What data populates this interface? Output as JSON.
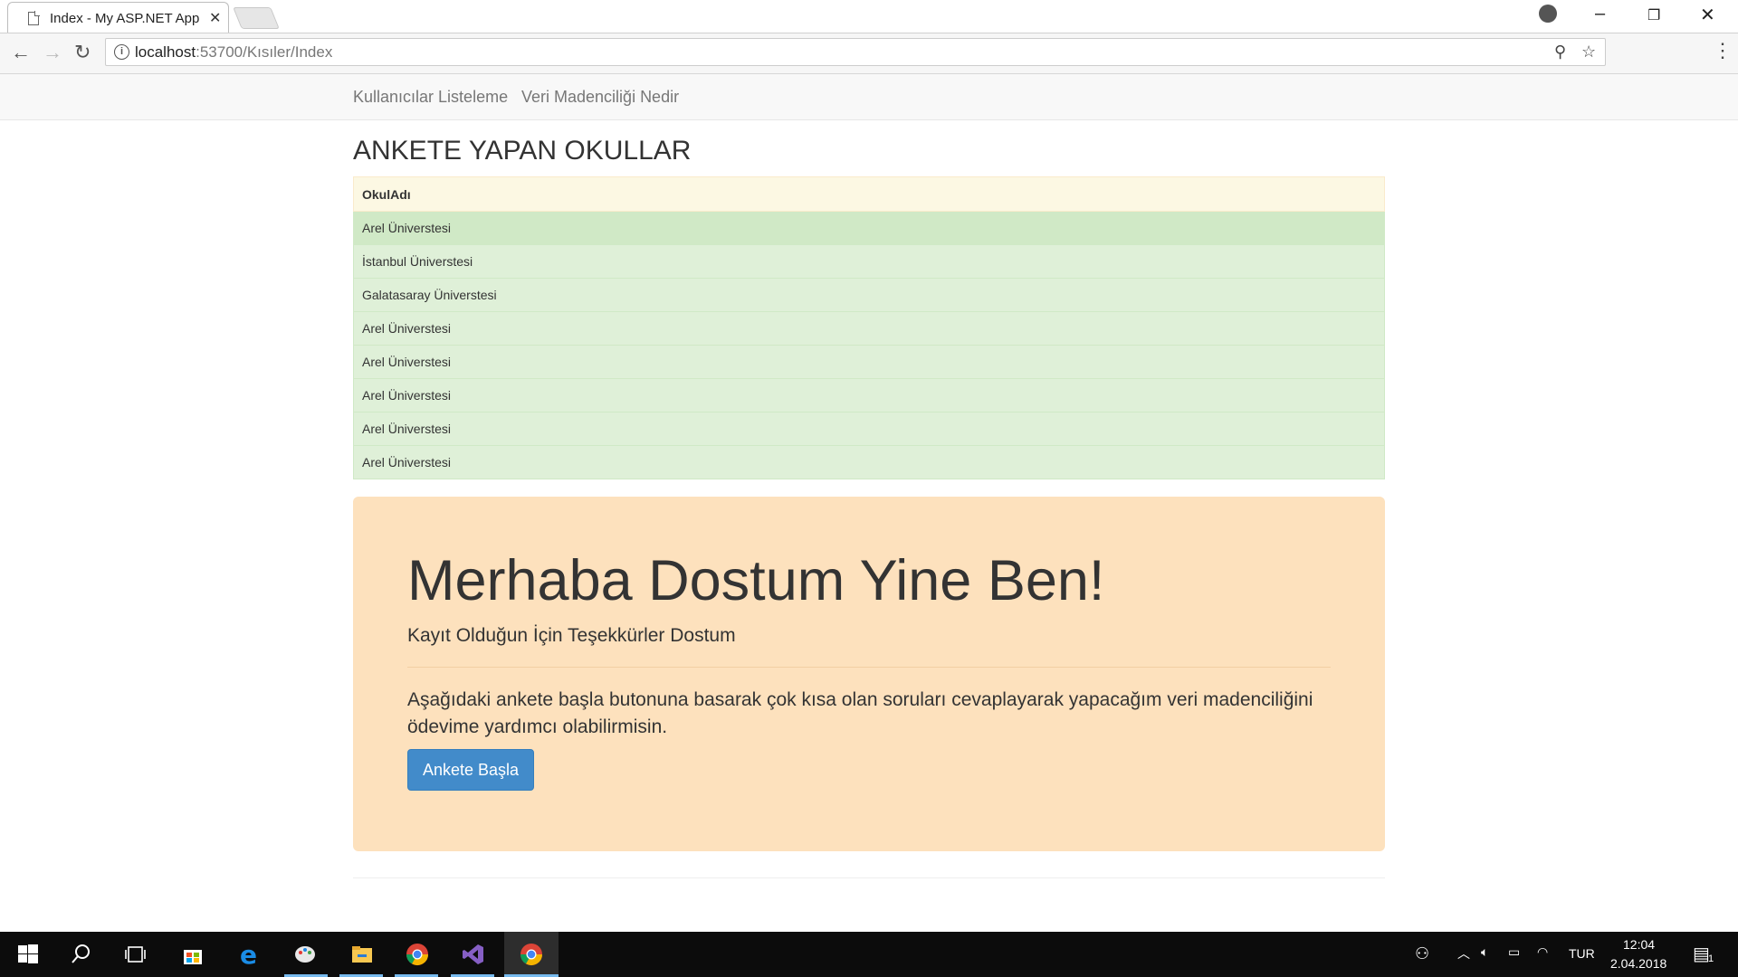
{
  "browser": {
    "tab_title": "Index - My ASP.NET App",
    "tab_close": "✕",
    "url_host": "localhost",
    "url_rest": ":53700/Kısıler/Index"
  },
  "navbar": {
    "links": [
      "Kullanıcılar Listeleme",
      "Veri Madenciliği Nedir"
    ]
  },
  "page": {
    "title": "ANKETE YAPAN OKULLAR",
    "table": {
      "header": "OkulAdı",
      "rows": [
        "Arel Üniverstesi",
        "İstanbul Üniverstesi",
        "Galatasaray Üniverstesi",
        "Arel Üniverstesi",
        "Arel Üniverstesi",
        "Arel Üniverstesi",
        "Arel Üniverstesi",
        "Arel Üniverstesi"
      ]
    },
    "jumbotron": {
      "heading": "Merhaba Dostum Yine Ben!",
      "subheading": "Kayıt Olduğun İçin Teşekkürler Dostum",
      "text": "Aşağıdaki ankete başla butonuna basarak çok kısa olan soruları cevaplayarak yapacağım veri madenciliğini ödevime yardımcı olabilirmisin.",
      "button": "Ankete Başla"
    }
  },
  "taskbar": {
    "language": "TUR",
    "time": "12:04",
    "date": "2.04.2018",
    "notification_count": "1"
  },
  "colors": {
    "table_header_bg": "#fcf8e3",
    "table_row_bg": "#dff0d8",
    "jumbotron_bg": "#fde1bd",
    "button_bg": "#428bca",
    "taskbar_bg": "#0c0c0c"
  }
}
